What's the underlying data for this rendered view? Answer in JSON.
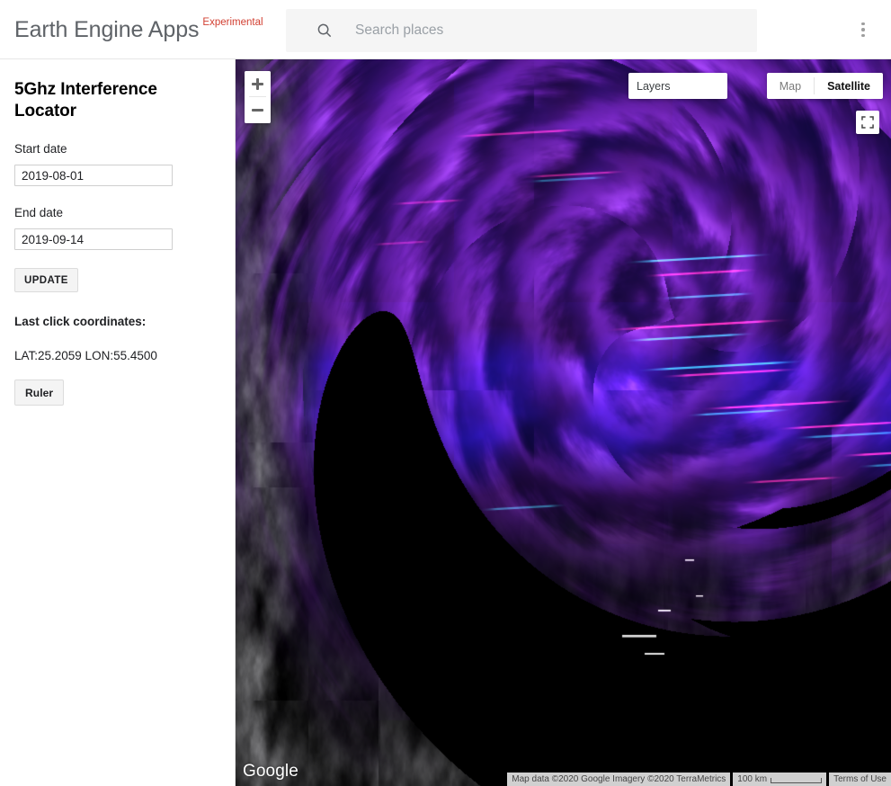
{
  "header": {
    "brand_title": "Earth Engine Apps",
    "brand_tag": "Experimental",
    "search_placeholder": "Search places",
    "search_value": "",
    "search_icon": "search-icon",
    "overflow_icon": "more-vert-icon"
  },
  "sidebar": {
    "panel_title": "5Ghz Interference Locator",
    "start_date_label": "Start date",
    "start_date_value": "2019-08-01",
    "end_date_label": "End date",
    "end_date_value": "2019-09-14",
    "update_button": "UPDATE",
    "coords_label": "Last click coordinates:",
    "coords_value": "LAT:25.2059 LON:55.4500",
    "ruler_button": "Ruler"
  },
  "map": {
    "zoom_in_icon": "plus-icon",
    "zoom_out_icon": "minus-icon",
    "layers_label": "Layers",
    "maptype_map": "Map",
    "maptype_satellite": "Satellite",
    "maptype_active": "Satellite",
    "fullscreen_icon": "fullscreen-icon",
    "google_logo": "Google",
    "attribution": "Map data ©2020 Google Imagery ©2020 TerraMetrics",
    "scale_label": "100 km",
    "terms_label": "Terms of Use"
  },
  "colors": {
    "accent_red": "#d23f31",
    "header_text": "#5f6368",
    "search_bg": "#f5f5f5",
    "body_text": "#202124",
    "map_dark": "#05030d",
    "map_purple": "#7a3fc4",
    "map_blue": "#1a1f8c",
    "streak_magenta": "#ff2d7a",
    "streak_cyan": "#1fd8c8"
  }
}
